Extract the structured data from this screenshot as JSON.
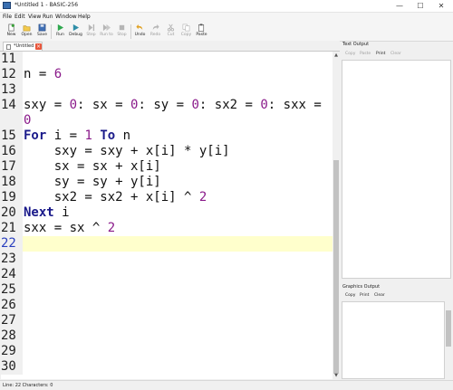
{
  "window": {
    "title": "*Untitled 1 - BASIC-256",
    "minimize": "—",
    "maximize": "☐",
    "close": "✕"
  },
  "menu": [
    "File",
    "Edit",
    "View",
    "Run",
    "Window",
    "Help"
  ],
  "toolbar": [
    {
      "label": "New",
      "icon": "new-file-icon",
      "enabled": true
    },
    {
      "label": "Open",
      "icon": "open-folder-icon",
      "enabled": true
    },
    {
      "label": "Save",
      "icon": "save-disk-icon",
      "enabled": true
    },
    {
      "label": "Run",
      "icon": "run-play-icon",
      "enabled": true
    },
    {
      "label": "Debug",
      "icon": "debug-play-icon",
      "enabled": true
    },
    {
      "label": "Step",
      "icon": "step-icon",
      "enabled": false
    },
    {
      "label": "Run to",
      "icon": "run-to-icon",
      "enabled": false
    },
    {
      "label": "Stop",
      "icon": "stop-icon",
      "enabled": false
    },
    {
      "label": "Undo",
      "icon": "undo-icon",
      "enabled": true
    },
    {
      "label": "Redo",
      "icon": "redo-icon",
      "enabled": false
    },
    {
      "label": "Cut",
      "icon": "cut-scissors-icon",
      "enabled": false
    },
    {
      "label": "Copy",
      "icon": "copy-icon",
      "enabled": false
    },
    {
      "label": "Paste",
      "icon": "paste-clipboard-icon",
      "enabled": true
    }
  ],
  "tab": {
    "label": "*Untitled 1",
    "close": "×"
  },
  "editor": {
    "lines": [
      {
        "n": "11",
        "tokens": []
      },
      {
        "n": "12",
        "tokens": [
          {
            "t": "n = ",
            "c": "plain"
          },
          {
            "t": "6",
            "c": "num"
          }
        ]
      },
      {
        "n": "13",
        "tokens": []
      },
      {
        "n": "14",
        "tokens": [
          {
            "t": "sxy = ",
            "c": "plain"
          },
          {
            "t": "0",
            "c": "num"
          },
          {
            "t": ": sx = ",
            "c": "plain"
          },
          {
            "t": "0",
            "c": "num"
          },
          {
            "t": ": sy = ",
            "c": "plain"
          },
          {
            "t": "0",
            "c": "num"
          },
          {
            "t": ": sx2 = ",
            "c": "plain"
          },
          {
            "t": "0",
            "c": "num"
          },
          {
            "t": ": sxx =",
            "c": "plain"
          }
        ]
      },
      {
        "n": "",
        "tokens": [
          {
            "t": "0",
            "c": "num"
          }
        ]
      },
      {
        "n": "15",
        "tokens": [
          {
            "t": "For",
            "c": "kw"
          },
          {
            "t": " i = ",
            "c": "plain"
          },
          {
            "t": "1",
            "c": "num"
          },
          {
            "t": " ",
            "c": "plain"
          },
          {
            "t": "To",
            "c": "kw"
          },
          {
            "t": " n",
            "c": "plain"
          }
        ]
      },
      {
        "n": "16",
        "tokens": [
          {
            "t": "    sxy = sxy + x[i] * y[i]",
            "c": "plain"
          }
        ]
      },
      {
        "n": "17",
        "tokens": [
          {
            "t": "    sx = sx + x[i]",
            "c": "plain"
          }
        ]
      },
      {
        "n": "18",
        "tokens": [
          {
            "t": "    sy = sy + y[i]",
            "c": "plain"
          }
        ]
      },
      {
        "n": "19",
        "tokens": [
          {
            "t": "    sx2 = sx2 + x[i] ^ ",
            "c": "plain"
          },
          {
            "t": "2",
            "c": "num"
          }
        ]
      },
      {
        "n": "20",
        "tokens": [
          {
            "t": "Next",
            "c": "kw"
          },
          {
            "t": " i",
            "c": "plain"
          }
        ]
      },
      {
        "n": "21",
        "tokens": [
          {
            "t": "sxx = sx ^ ",
            "c": "plain"
          },
          {
            "t": "2",
            "c": "num"
          }
        ]
      },
      {
        "n": "22",
        "tokens": [],
        "current": true
      },
      {
        "n": "23",
        "tokens": []
      },
      {
        "n": "24",
        "tokens": []
      },
      {
        "n": "25",
        "tokens": []
      },
      {
        "n": "26",
        "tokens": []
      },
      {
        "n": "27",
        "tokens": []
      },
      {
        "n": "28",
        "tokens": []
      },
      {
        "n": "29",
        "tokens": []
      },
      {
        "n": "30",
        "tokens": []
      }
    ]
  },
  "text_output": {
    "title": "Text Output",
    "buttons": [
      {
        "label": "Copy",
        "enabled": false
      },
      {
        "label": "Paste",
        "enabled": false
      },
      {
        "label": "Print",
        "enabled": true
      },
      {
        "label": "Clear",
        "enabled": false
      }
    ]
  },
  "graphics_output": {
    "title": "Graphics Output",
    "buttons": [
      {
        "label": "Copy",
        "enabled": true
      },
      {
        "label": "Print",
        "enabled": true
      },
      {
        "label": "Clear",
        "enabled": true
      }
    ]
  },
  "status": "Line: 22 Characters: 0",
  "colors": {
    "current_line": "#ffffcc",
    "number": "#8a1a8a",
    "keyword": "#1a1a8a"
  }
}
